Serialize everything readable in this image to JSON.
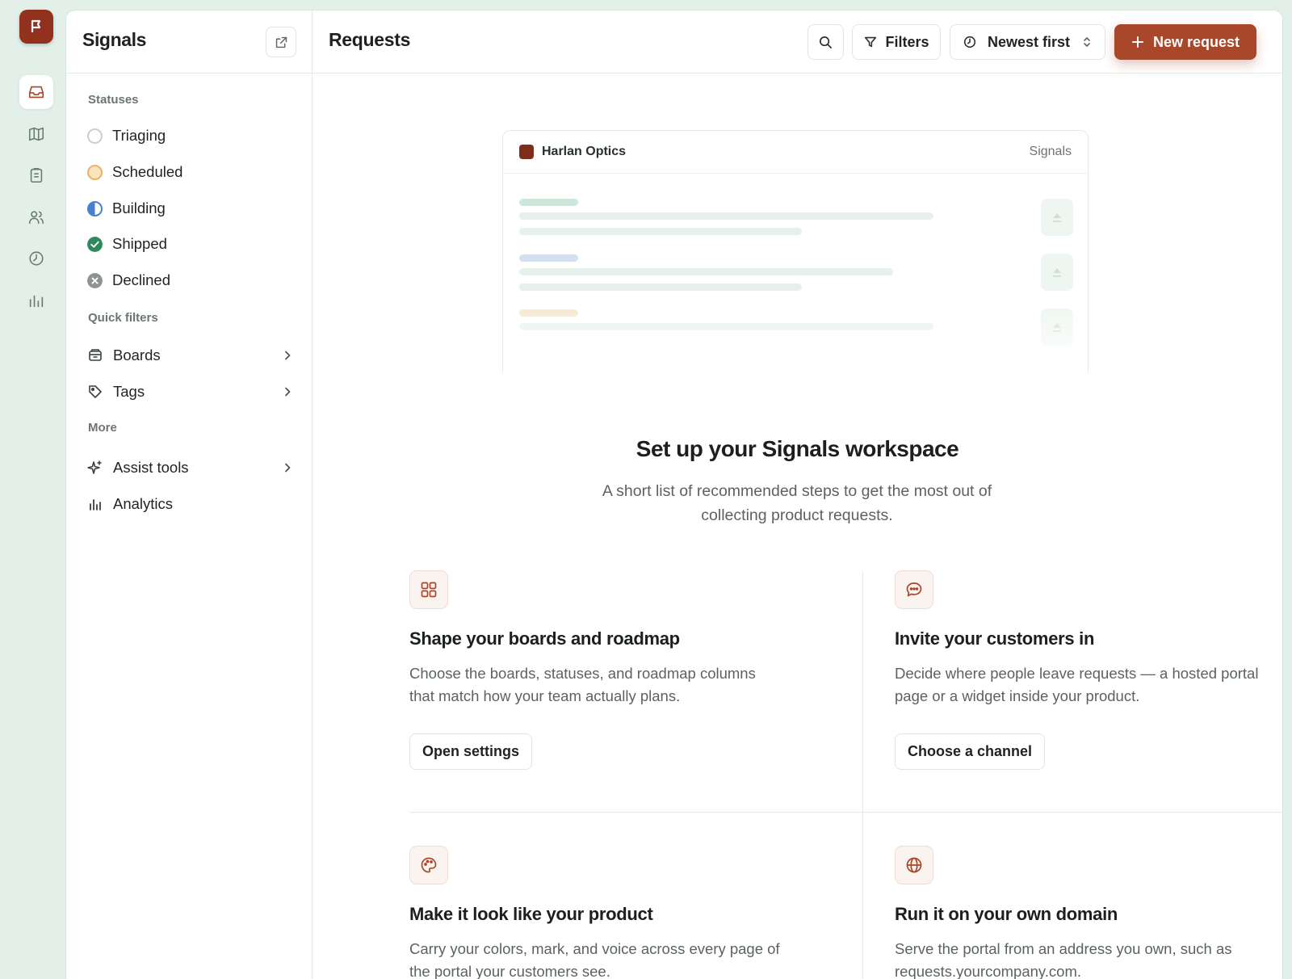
{
  "app": {
    "logo_icon": "flag-icon",
    "rail": [
      "inbox-icon",
      "map-icon",
      "clipboard-icon",
      "users-icon",
      "clock-icon",
      "bar-chart-icon"
    ]
  },
  "sidebar": {
    "title": "Signals",
    "statuses_label": "Statuses",
    "statuses": [
      {
        "label": "Triaging",
        "color": "#c9cfcc"
      },
      {
        "label": "Scheduled",
        "color": "#f2c27c"
      },
      {
        "label": "Building",
        "color": "#4a7fd0"
      },
      {
        "label": "Shipped",
        "color": "#2f8a5b"
      },
      {
        "label": "Declined",
        "color": "#8d9390"
      }
    ],
    "quick_filters_label": "Quick filters",
    "quick_filters": [
      {
        "label": "Boards",
        "icon": "archive-box-icon"
      },
      {
        "label": "Tags",
        "icon": "tag-icon"
      }
    ],
    "more_label": "More",
    "more": [
      {
        "label": "Assist tools",
        "icon": "sparkle-icon"
      },
      {
        "label": "Analytics",
        "icon": "bar-chart-icon"
      }
    ]
  },
  "topbar": {
    "title": "Requests",
    "filters_label": "Filters",
    "sort_label": "Newest first",
    "new_request_label": "New request",
    "accent": "#a9472a"
  },
  "preview": {
    "brand": "Harlan Optics",
    "tag": "Signals"
  },
  "hero": {
    "title": "Set up your Signals workspace",
    "subtitle": "A short list of recommended steps to get the most out of collecting product requests."
  },
  "steps": [
    {
      "icon": "grid-icon",
      "title": "Shape your boards and roadmap",
      "description": "Choose the boards, statuses, and roadmap columns that match how your team actually plans.",
      "button": "Open settings"
    },
    {
      "icon": "chat-bubble-icon",
      "title": "Invite your customers in",
      "description": "Decide where people leave requests — a hosted portal page or a widget inside your product.",
      "button": "Choose a channel"
    },
    {
      "icon": "palette-icon",
      "title": "Make it look like your product",
      "description": "Carry your colors, mark, and voice across every page of the portal your customers see."
    },
    {
      "icon": "globe-icon",
      "title": "Run it on your own domain",
      "description": "Serve the portal from an address you own, such as requests.yourcompany.com."
    }
  ]
}
